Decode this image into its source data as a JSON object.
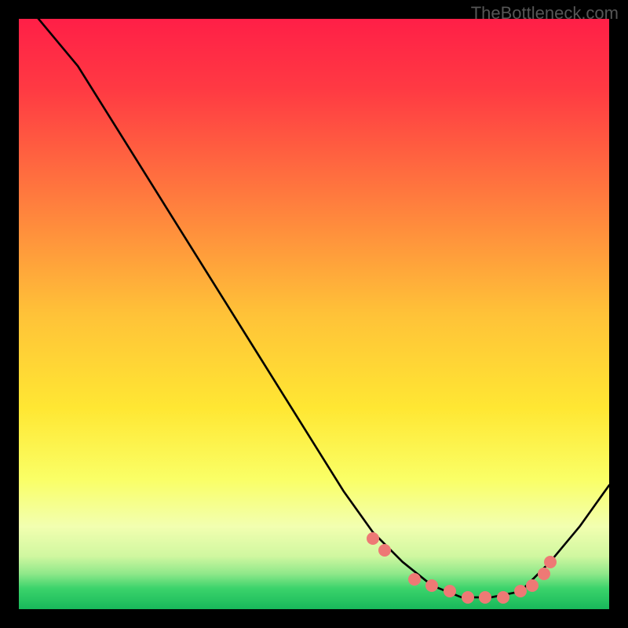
{
  "watermark": "TheBottleneck.com",
  "chart_data": {
    "type": "line",
    "title": "",
    "xlabel": "",
    "ylabel": "",
    "xlim": [
      0,
      100
    ],
    "ylim": [
      0,
      100
    ],
    "series": [
      {
        "name": "curve",
        "x": [
          0,
          5,
          10,
          15,
          20,
          25,
          30,
          35,
          40,
          45,
          50,
          55,
          60,
          65,
          70,
          75,
          80,
          85,
          90,
          95,
          100
        ],
        "y": [
          104,
          98,
          92,
          84,
          76,
          68,
          60,
          52,
          44,
          36,
          28,
          20,
          13,
          8,
          4,
          2,
          2,
          3,
          8,
          14,
          21
        ]
      },
      {
        "name": "dots",
        "x": [
          60,
          62,
          67,
          70,
          73,
          76,
          79,
          82,
          85,
          87,
          89,
          90
        ],
        "y": [
          12,
          10,
          5,
          4,
          3,
          2,
          2,
          2,
          3,
          4,
          6,
          8
        ]
      }
    ],
    "background_gradient": {
      "top": "#ff1f47",
      "mid_upper": "#ff9a3e",
      "mid": "#ffe733",
      "mid_lower": "#f6ff8a",
      "green": "#3bd36b",
      "bottom": "#18b85a"
    }
  }
}
